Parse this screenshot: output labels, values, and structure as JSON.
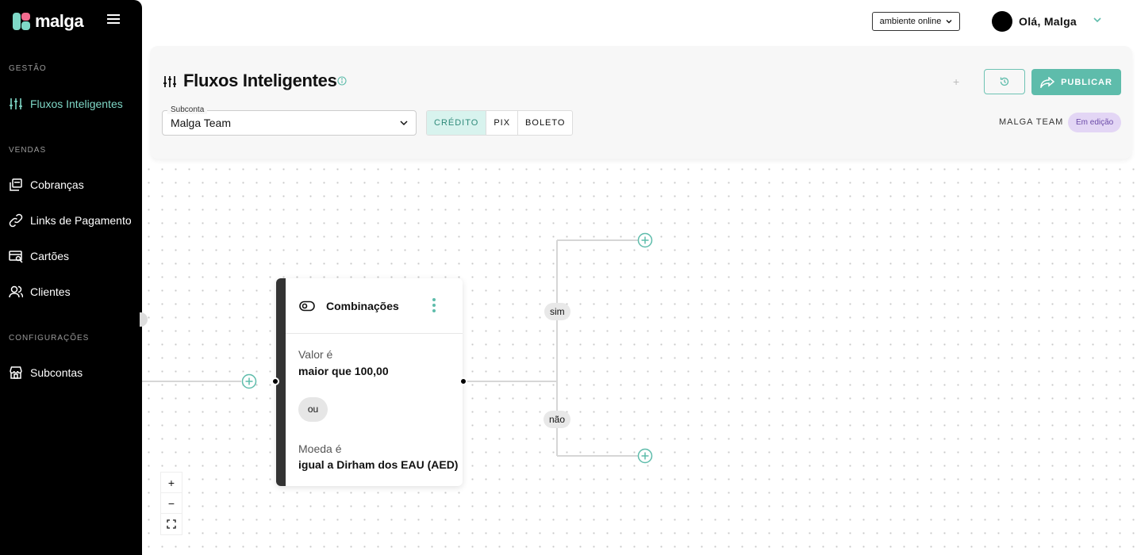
{
  "brand": {
    "name": "malga"
  },
  "sidebar": {
    "sections": [
      {
        "title": "GESTÃO"
      },
      {
        "title": "VENDAS"
      },
      {
        "title": "CONFIGURAÇÕES"
      }
    ],
    "items": [
      {
        "label": "Fluxos Inteligentes",
        "icon": "sliders-icon",
        "active": true
      },
      {
        "label": "Cobranças",
        "icon": "charges-icon"
      },
      {
        "label": "Links de Pagamento",
        "icon": "link-icon"
      },
      {
        "label": "Cartões",
        "icon": "card-search-icon"
      },
      {
        "label": "Clientes",
        "icon": "users-icon"
      },
      {
        "label": "Subcontas",
        "icon": "store-icon"
      }
    ]
  },
  "topbar": {
    "environment": "ambiente online",
    "greeting": "Olá, Malga"
  },
  "header": {
    "title": "Fluxos Inteligentes",
    "publish_label": "PUBLICAR",
    "subconta_label": "Subconta",
    "subconta_value": "Malga Team",
    "tabs": [
      {
        "label": "CRÉDITO",
        "active": true
      },
      {
        "label": "PIX"
      },
      {
        "label": "BOLETO"
      }
    ],
    "team": "MALGA TEAM",
    "status": "Em edição"
  },
  "flow": {
    "node_title": "Combinações",
    "conditions": [
      {
        "label": "Valor é",
        "value": "maior que 100,00"
      },
      {
        "label": "Moeda é",
        "value": "igual a Dirham dos EAU (AED)"
      }
    ],
    "operator": "ou",
    "branch_yes": "sim",
    "branch_no": "não"
  },
  "zoom": {
    "in": "+",
    "out": "−"
  },
  "colors": {
    "accent": "#5ebcab",
    "active_nav": "#7fd8c7",
    "status_bg": "#e3d6f5"
  }
}
